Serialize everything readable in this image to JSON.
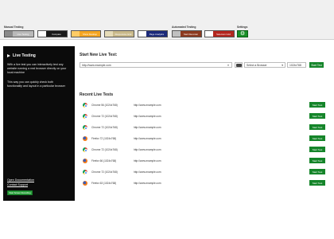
{
  "toolbar": {
    "groups": {
      "manual": "Manual Testing",
      "automated": "Automated Testing",
      "settings": "Settings"
    },
    "buttons": [
      {
        "label": "Live Testing",
        "color": "#b9b9b9",
        "swatch": "#8a8a8a"
      },
      {
        "label": "Compare",
        "color": "#1a1a1a",
        "swatch": "#ffffff"
      },
      {
        "label": "Show Desktop",
        "color": "#f5a623",
        "swatch": "#ffcc66"
      },
      {
        "label": "Responsive Grid",
        "color": "#c9b98a",
        "swatch": "#e6dcb8"
      },
      {
        "label": "Page Analytics",
        "color": "#1c2a7a",
        "swatch": "#ffffff"
      },
      {
        "label": "Start Recorder",
        "color": "#8c3a1f",
        "swatch": "#c0c0c0"
      },
      {
        "label": "Selenium Grid",
        "color": "#b3261e",
        "swatch": "#ffffff"
      }
    ],
    "settings_icon": "gear-icon"
  },
  "sidebar": {
    "title": "Live Testing",
    "p1": "With a live test you can interactively test any website running a real browser directly on your local machine",
    "p2": "This way you can quickly check both functionality and layout in a particular browser",
    "link_docs": "Open Documentation",
    "link_support": "Contact Support",
    "record_button": "Start Screen Recording"
  },
  "main": {
    "start_heading": "Start New Live Test:",
    "url_value": "http://www.example.com",
    "browser_placeholder": "Select a Browser",
    "resolution_value": "1024x768",
    "start_button": "Start Test",
    "recent_heading": "Recent Live Tests"
  },
  "recent": [
    {
      "browser": "Chrome 56 (1024x768)",
      "url": "http://www.example.com",
      "icon": "chrome-icon",
      "action": "Start Test"
    },
    {
      "browser": "Chrome 72 (1024x768)",
      "url": "http://www.example.com",
      "icon": "chrome-icon",
      "action": "Start Test"
    },
    {
      "browser": "Chrome 72 (1024x768)",
      "url": "http://www.example.com",
      "icon": "chrome-icon",
      "action": "Start Test"
    },
    {
      "browser": "Firefox 72 (1024x768)",
      "url": "http://www.example.com",
      "icon": "firefox-icon",
      "action": "Start Test"
    },
    {
      "browser": "Chrome 72 (1024x768)",
      "url": "http://www.example.com",
      "icon": "chrome-icon",
      "action": "Start Test"
    },
    {
      "browser": "Firefox 66 (1024x768)",
      "url": "http://www.example.com",
      "icon": "firefox-icon",
      "action": "Start Test"
    },
    {
      "browser": "Chrome 72 (1024x768)",
      "url": "http://www.example.com",
      "icon": "chrome-icon",
      "action": "Start Test"
    },
    {
      "browser": "Firefox 63 (1024x768)",
      "url": "http://www.example.com",
      "icon": "firefox-icon",
      "action": "Start Test"
    }
  ]
}
